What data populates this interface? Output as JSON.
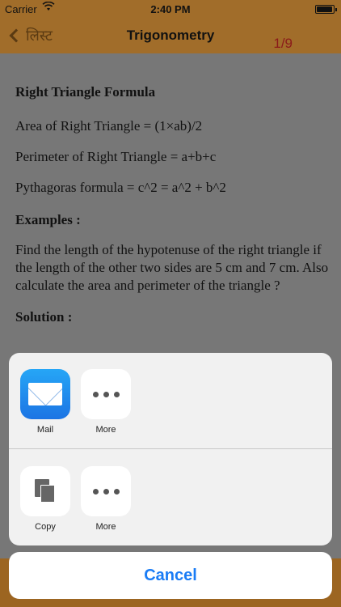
{
  "status": {
    "carrier": "Carrier",
    "time": "2:40 PM",
    "battery_level": 0.95
  },
  "nav": {
    "back_label": "लिस्ट",
    "title": "Trigonometry",
    "pager": "1/9"
  },
  "content": {
    "heading": "Right Triangle Formula",
    "area": "Area of Right Triangle = (1×ab)/2",
    "perimeter": "Perimeter of Right Triangle = a+b+c",
    "pythagoras": "Pythagoras formula = c^2 = a^2 + b^2",
    "examples_heading": "Examples :",
    "example_text": "Find the length of the hypotenuse of the right triangle if the length of the other two sides are 5 cm and 7 cm. Also calculate the area and perimeter of the triangle ?",
    "solution_heading": "Solution :"
  },
  "share_sheet": {
    "row1": [
      {
        "label": "Mail",
        "icon": "mail-icon"
      },
      {
        "label": "More",
        "icon": "more-icon"
      }
    ],
    "row2": [
      {
        "label": "Copy",
        "icon": "copy-icon"
      },
      {
        "label": "More",
        "icon": "more-icon"
      }
    ],
    "cancel_label": "Cancel"
  },
  "colors": {
    "nav_bg": "#a16d2a",
    "accent": "#1a7cf5",
    "pager": "#8b1a1a"
  }
}
